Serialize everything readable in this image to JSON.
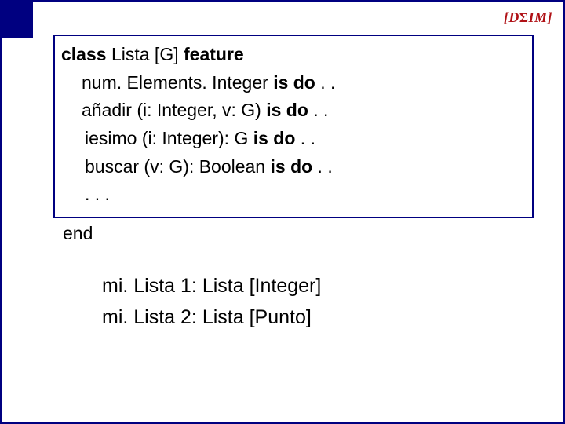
{
  "logo": {
    "left": "[D",
    "sigma": "Σ",
    "right": "IM]"
  },
  "code": {
    "l1": {
      "a": "class ",
      "b": "Lista [G] ",
      "c": "feature"
    },
    "l2": {
      "a": "num. Elements. Integer ",
      "b": "is do",
      "c": " . ."
    },
    "l3": {
      "a": "añadir (i: Integer, v: G) ",
      "b": "is do",
      "c": " . ."
    },
    "l4": {
      "a": "iesimo (i: Integer): G ",
      "b": "is do",
      "c": " . ."
    },
    "l5": {
      "a": "buscar (v: G): Boolean ",
      "b": "is do",
      "c": " . ."
    },
    "l6": ". . .",
    "end": "end"
  },
  "decl": {
    "d1": "mi. Lista 1: Lista [Integer]",
    "d2": "mi. Lista 2: Lista [Punto]"
  }
}
